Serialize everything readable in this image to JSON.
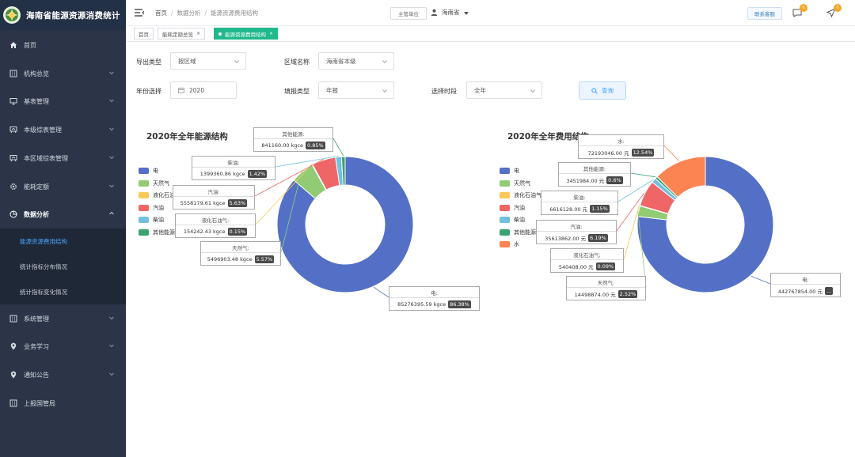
{
  "app": {
    "title": "海南省能源资源消费统计",
    "logo": "logo-emblem-icon"
  },
  "sidebar": {
    "items": [
      {
        "label": "首页",
        "icon": "home-icon"
      },
      {
        "label": "机构总览",
        "icon": "building-icon"
      },
      {
        "label": "基表管理",
        "icon": "monitor-icon"
      },
      {
        "label": "本级综表管理",
        "icon": "chart-board-icon"
      },
      {
        "label": "本区域综表管理",
        "icon": "chart-board-icon"
      },
      {
        "label": "能耗定额",
        "icon": "gear-icon"
      },
      {
        "label": "数据分析",
        "icon": "pie-icon"
      },
      {
        "label": "系统管理",
        "icon": "building-icon"
      },
      {
        "label": "业务学习",
        "icon": "location-icon"
      },
      {
        "label": "通知公告",
        "icon": "location-icon"
      },
      {
        "label": "上报国管局",
        "icon": "building-icon"
      }
    ],
    "submenu": [
      {
        "label": "能源资源费用结构"
      },
      {
        "label": "统计指标分布情况"
      },
      {
        "label": "统计指标变化情况"
      }
    ]
  },
  "header": {
    "breadcrumb": [
      "首页",
      "数据分析",
      "能源资源费用结构"
    ],
    "org_label": "主管单位",
    "user": "海南省",
    "contact": "联系客服",
    "message_count": "0",
    "notice_count": "0"
  },
  "tabs": [
    {
      "label": "首页"
    },
    {
      "label": "能耗定额总览"
    },
    {
      "label": "能源资源费用结构"
    }
  ],
  "filters": {
    "export_type": {
      "label": "导出类型",
      "value": "按区域"
    },
    "region": {
      "label": "区域名称",
      "value": "海南省本级"
    },
    "year": {
      "label": "年份选择",
      "value": "2020"
    },
    "report_type": {
      "label": "填报类型",
      "value": "年报"
    },
    "period": {
      "label": "选择时段",
      "value": "全年"
    },
    "query_label": "查询"
  },
  "chart_data": [
    {
      "type": "pie",
      "title": "2020年全年能源结构",
      "unit": "kgce",
      "categories": [
        "电",
        "天然气",
        "液化石油气",
        "汽油",
        "柴油",
        "其他能源"
      ],
      "colors": [
        "#5470c6",
        "#91cc75",
        "#fac858",
        "#ee6666",
        "#73c0de",
        "#3ba272"
      ],
      "values": [
        85276395.59,
        5496903.48,
        154242.43,
        5558179.61,
        1399360.86,
        841160.0
      ],
      "value_labels": [
        "85276395.59 kgce",
        "5496903.48 kgce",
        "154242.43 kgce",
        "5558179.61 kgce",
        "1399360.86 kgce",
        "841160.00 kgce"
      ],
      "percent_labels": [
        "86.38%",
        "5.57%",
        "0.15%",
        "5.63%",
        "1.42%",
        "0.85%"
      ]
    },
    {
      "type": "pie",
      "title": "2020年全年费用结构",
      "unit": "元",
      "categories": [
        "电",
        "天然气",
        "液化石油气",
        "汽油",
        "柴油",
        "其他能源",
        "水"
      ],
      "colors": [
        "#5470c6",
        "#91cc75",
        "#fac858",
        "#ee6666",
        "#73c0de",
        "#3ba272",
        "#fc8452"
      ],
      "values": [
        442767854.0,
        14498874.0,
        540408.0,
        35613862.0,
        6616128.0,
        3451984.0,
        72193046.0
      ],
      "value_labels": [
        "442767854.00 元",
        "14498874.00 元",
        "540408.00 元",
        "35613862.00 元",
        "6616128.00 元",
        "3451984.00 元",
        "72193046.00 元"
      ],
      "percent_labels": [
        "...",
        "2.52%",
        "0.09%",
        "6.19%",
        "1.15%",
        "0.6%",
        "12.54%"
      ]
    }
  ]
}
